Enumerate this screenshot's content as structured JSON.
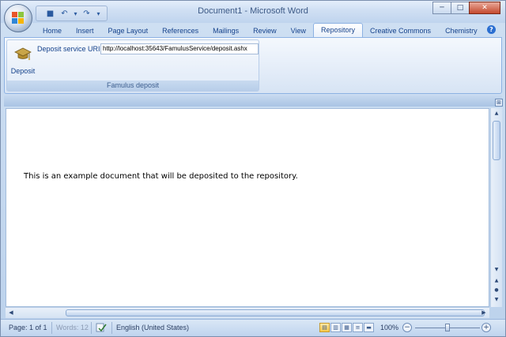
{
  "window": {
    "title": "Document1 - Microsoft Word",
    "controls": {
      "minimize": "─",
      "maximize": "□",
      "close": "✕"
    }
  },
  "qat": {
    "icons": [
      "save-icon",
      "undo-icon",
      "redo-icon",
      "customize-icon"
    ],
    "glyphs": {
      "save": "■",
      "undo": "↶",
      "undo_dropdown": "▾",
      "redo": "↷",
      "customize": "▾"
    }
  },
  "tabs": [
    {
      "label": "Home"
    },
    {
      "label": "Insert"
    },
    {
      "label": "Page Layout"
    },
    {
      "label": "References"
    },
    {
      "label": "Mailings"
    },
    {
      "label": "Review"
    },
    {
      "label": "View"
    },
    {
      "label": "Repository",
      "active": true
    },
    {
      "label": "Creative Commons"
    },
    {
      "label": "Chemistry"
    }
  ],
  "help_glyph": "?",
  "ribbon": {
    "group_label": "Famulus deposit",
    "deposit_button_label": "Deposit",
    "uri_label": "Deposit service URI",
    "uri_value": "http://localhost:35643/FamulusService/deposit.ashx"
  },
  "document": {
    "text": "This is an example document that will be deposited to the repository."
  },
  "scroll_glyphs": {
    "up": "▲",
    "down": "▼",
    "prev": "●",
    "left": "◀",
    "right": "▶",
    "ruler": "⊞"
  },
  "statusbar": {
    "page": "Page: 1 of 1",
    "words": "Words: 12",
    "language": "English (United States)",
    "zoom": "100%",
    "zoom_minus": "−",
    "zoom_plus": "+",
    "view_glyphs": [
      "▤",
      "▥",
      "▦",
      "≡",
      "▬"
    ]
  },
  "colors": {
    "ribbon_text": "#15428b",
    "active_tab_border": "#8db2e3",
    "close_button": "#c4492e"
  }
}
